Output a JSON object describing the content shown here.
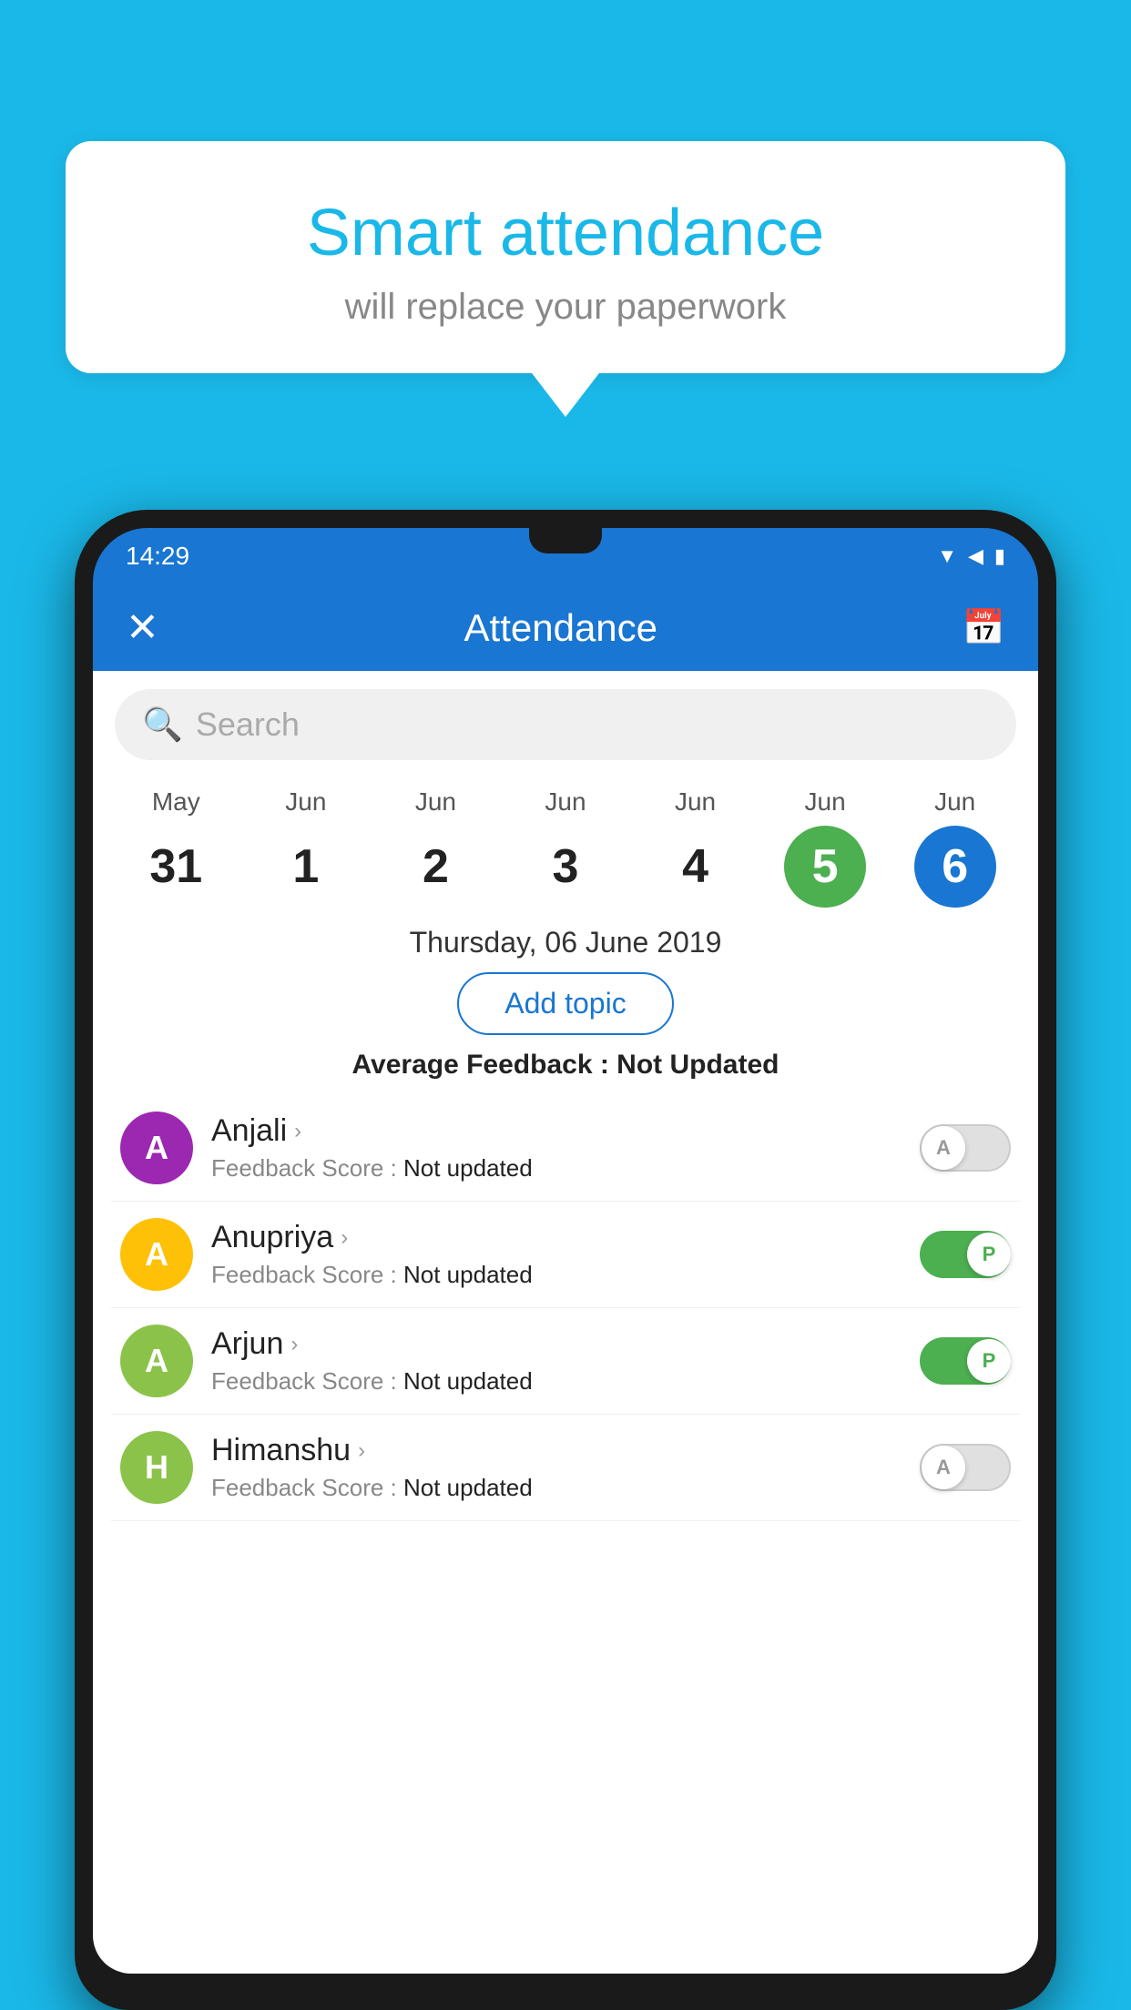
{
  "background_color": "#1ab8e8",
  "speech_bubble": {
    "title": "Smart attendance",
    "subtitle": "will replace your paperwork"
  },
  "status_bar": {
    "time": "14:29",
    "icons": [
      "▼",
      "◀",
      "▮"
    ]
  },
  "app_header": {
    "title": "Attendance",
    "close_label": "✕",
    "calendar_icon": "📅"
  },
  "search": {
    "placeholder": "Search"
  },
  "calendar": {
    "days": [
      {
        "month": "May",
        "date": "31",
        "style": "normal"
      },
      {
        "month": "Jun",
        "date": "1",
        "style": "normal"
      },
      {
        "month": "Jun",
        "date": "2",
        "style": "normal"
      },
      {
        "month": "Jun",
        "date": "3",
        "style": "normal"
      },
      {
        "month": "Jun",
        "date": "4",
        "style": "normal"
      },
      {
        "month": "Jun",
        "date": "5",
        "style": "green"
      },
      {
        "month": "Jun",
        "date": "6",
        "style": "blue"
      }
    ]
  },
  "selected_date": "Thursday, 06 June 2019",
  "add_topic_label": "Add topic",
  "average_feedback": {
    "label": "Average Feedback : ",
    "value": "Not Updated"
  },
  "students": [
    {
      "name": "Anjali",
      "avatar_letter": "A",
      "avatar_color": "#9c27b0",
      "feedback": "Not updated",
      "toggle": "off",
      "toggle_letter": "A"
    },
    {
      "name": "Anupriya",
      "avatar_letter": "A",
      "avatar_color": "#ffc107",
      "feedback": "Not updated",
      "toggle": "on",
      "toggle_letter": "P"
    },
    {
      "name": "Arjun",
      "avatar_letter": "A",
      "avatar_color": "#8bc34a",
      "feedback": "Not updated",
      "toggle": "on",
      "toggle_letter": "P"
    },
    {
      "name": "Himanshu",
      "avatar_letter": "H",
      "avatar_color": "#8bc34a",
      "feedback": "Not updated",
      "toggle": "off",
      "toggle_letter": "A"
    }
  ]
}
